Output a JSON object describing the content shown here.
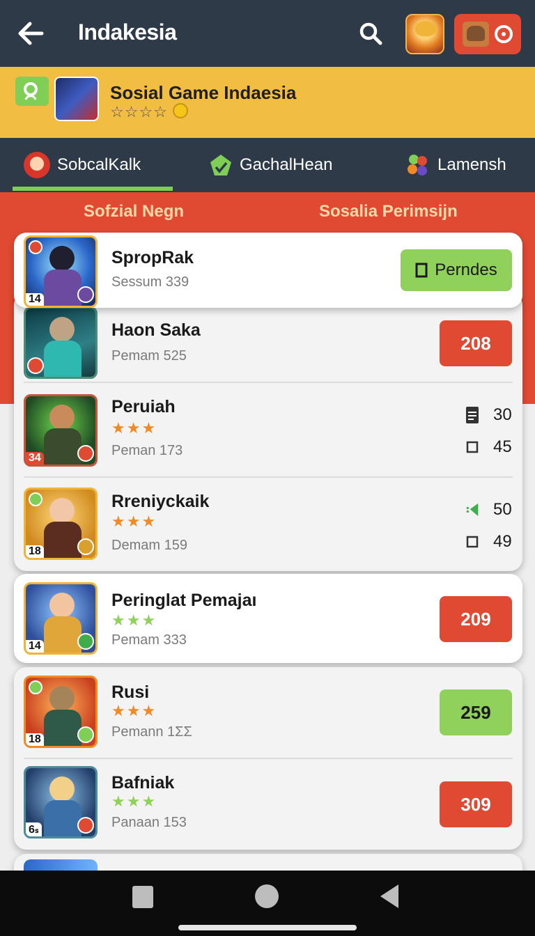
{
  "header": {
    "title": "Indakesia",
    "back_icon": "arrow-left-icon",
    "search_icon": "search-icon",
    "notification_icon": "notification-ring-icon"
  },
  "banner": {
    "title": "Sosial Game Indaesia",
    "stars": "☆☆☆☆",
    "search_icon": "search-icon",
    "coin_icon": "coin-icon"
  },
  "tabs": [
    {
      "label": "SobcalKalk",
      "icon": "avatar-icon"
    },
    {
      "label": "GachalHean",
      "icon": "gem-icon"
    },
    {
      "label": "Lamensh",
      "icon": "puzzle-icon"
    }
  ],
  "subtabs": [
    {
      "label": "Sofzial Negn"
    },
    {
      "label": "Sosalia Perimsijn"
    }
  ],
  "games": [
    {
      "name": "SpropRak",
      "sub": "Sessum 339",
      "level": "14",
      "action": "Perndes",
      "action_icon": "square-icon"
    },
    {
      "name": "Haon Saka",
      "sub": "Pemam 525",
      "value": "208"
    },
    {
      "name": "Peruiah",
      "stars": "★★★",
      "sub": "Peman 173",
      "level": "34",
      "stat1_value": "30",
      "stat1_icon": "document-icon",
      "stat2_value": "45",
      "stat2_icon": "square-icon"
    },
    {
      "name": "Rreniyckaik",
      "stars": "★★★",
      "sub": "Demam 159",
      "level": "18",
      "stat1_value": "50",
      "stat1_icon": "leaf-icon",
      "stat2_value": "49",
      "stat2_icon": "square-icon"
    },
    {
      "name": "Peringlat Pemajaı",
      "stars": "★★★",
      "sub": "Pemam 333",
      "level": "14",
      "value": "209"
    },
    {
      "name": "Rusi",
      "stars": "★★★",
      "sub": "Pemann 1ΣΣ",
      "level": "18",
      "value": "259"
    },
    {
      "name": "Bafniak",
      "stars": "★★★",
      "sub": "Panaan 153",
      "level": "6ₛ",
      "value": "309"
    }
  ],
  "colors": {
    "header_bg": "#2e3a48",
    "banner_bg": "#f2bd43",
    "accent_red": "#e04a33",
    "accent_green": "#8fd15a",
    "star_orange": "#f08a24"
  },
  "system_nav": {
    "recents_icon": "square-nav-icon",
    "home_icon": "circle-nav-icon",
    "back_icon": "triangle-back-icon"
  }
}
